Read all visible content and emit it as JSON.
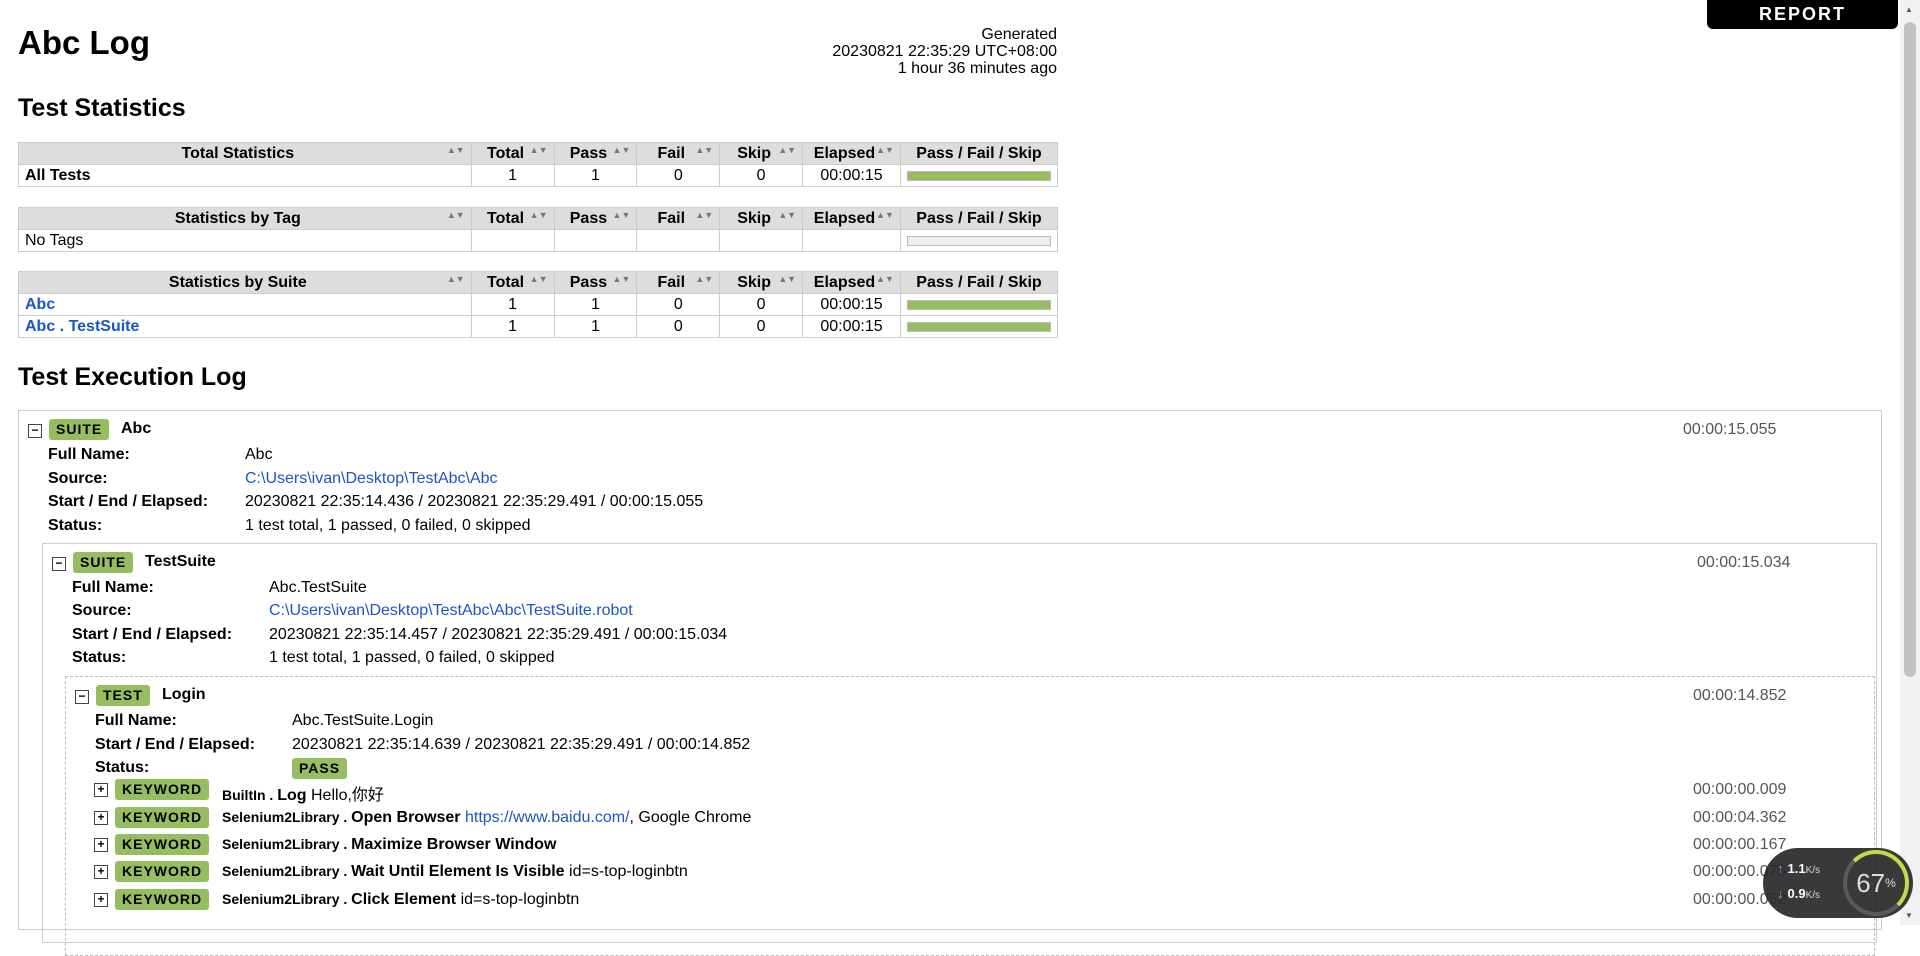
{
  "report_button": "REPORT",
  "title": "Abc Log",
  "generated": {
    "label": "Generated",
    "timestamp": "20230821 22:35:29 UTC+08:00",
    "ago": "1 hour 36 minutes ago"
  },
  "statistics": {
    "heading": "Test Statistics",
    "columns": [
      "Total",
      "Pass",
      "Fail",
      "Skip",
      "Elapsed",
      "Pass / Fail / Skip"
    ],
    "total": {
      "header": "Total Statistics",
      "rows": [
        {
          "name": "All Tests",
          "total": "1",
          "pass": "1",
          "fail": "0",
          "skip": "0",
          "elapsed": "00:00:15",
          "pass_fraction": 1.0
        }
      ]
    },
    "tag": {
      "header": "Statistics by Tag",
      "empty_text": "No Tags"
    },
    "suite": {
      "header": "Statistics by Suite",
      "rows": [
        {
          "name": "Abc",
          "total": "1",
          "pass": "1",
          "fail": "0",
          "skip": "0",
          "elapsed": "00:00:15",
          "pass_fraction": 1.0
        },
        {
          "name": "Abc . TestSuite",
          "total": "1",
          "pass": "1",
          "fail": "0",
          "skip": "0",
          "elapsed": "00:00:15",
          "pass_fraction": 1.0
        }
      ]
    }
  },
  "execution_log": {
    "heading": "Test Execution Log",
    "labels": {
      "full_name": "Full Name:",
      "source": "Source:",
      "start_end": "Start / End / Elapsed:",
      "status": "Status:"
    },
    "suite1": {
      "type": "SUITE",
      "name": "Abc",
      "elapsed": "00:00:15.055",
      "full_name": "Abc",
      "source": "C:\\Users\\ivan\\Desktop\\TestAbc\\Abc",
      "times": "20230821 22:35:14.436 / 20230821 22:35:29.491 / 00:00:15.055",
      "status": "1 test total, 1 passed, 0 failed, 0 skipped"
    },
    "suite2": {
      "type": "SUITE",
      "name": "TestSuite",
      "elapsed": "00:00:15.034",
      "full_name": "Abc.TestSuite",
      "source": "C:\\Users\\ivan\\Desktop\\TestAbc\\Abc\\TestSuite.robot",
      "times": "20230821 22:35:14.457 / 20230821 22:35:29.491 / 00:00:15.034",
      "status": "1 test total, 1 passed, 0 failed, 0 skipped"
    },
    "test": {
      "type": "TEST",
      "name": "Login",
      "elapsed": "00:00:14.852",
      "full_name": "Abc.TestSuite.Login",
      "times": "20230821 22:35:14.639 / 20230821 22:35:29.491 / 00:00:14.852",
      "status": "PASS"
    },
    "keywords": [
      {
        "type": "KEYWORD",
        "lib": "BuiltIn",
        "name": "Log",
        "args": "Hello,你好",
        "link": "",
        "args_after": "",
        "elapsed": "00:00:00.009"
      },
      {
        "type": "KEYWORD",
        "lib": "Selenium2Library",
        "name": "Open Browser",
        "args": "",
        "link": "https://www.baidu.com/",
        "args_after": ", Google Chrome",
        "elapsed": "00:00:04.362"
      },
      {
        "type": "KEYWORD",
        "lib": "Selenium2Library",
        "name": "Maximize Browser Window",
        "args": "",
        "link": "",
        "args_after": "",
        "elapsed": "00:00:00.167"
      },
      {
        "type": "KEYWORD",
        "lib": "Selenium2Library",
        "name": "Wait Until Element Is Visible",
        "args": "id=s-top-loginbtn",
        "link": "",
        "args_after": "",
        "elapsed": "00:00:00.075"
      },
      {
        "type": "KEYWORD",
        "lib": "Selenium2Library",
        "name": "Click Element",
        "args": "id=s-top-loginbtn",
        "link": "",
        "args_after": "",
        "elapsed": "00:00:00.052"
      }
    ]
  },
  "network_widget": {
    "upload": "1.1",
    "download": "0.9",
    "unit": "K/s",
    "percent": "67",
    "percent_sign": "%"
  },
  "toggle": {
    "collapse": "−",
    "expand": "+"
  },
  "sort_glyph": "▲▼"
}
